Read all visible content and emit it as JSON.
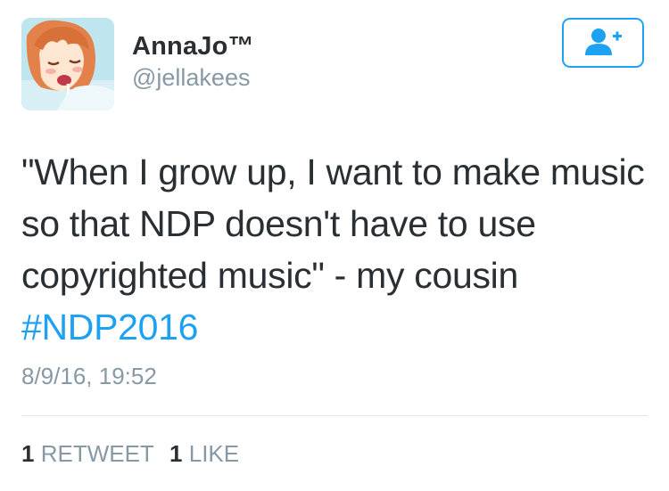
{
  "user": {
    "display_name": "AnnaJo™",
    "handle": "@jellakees",
    "avatar_icon": "anime-avatar"
  },
  "follow_button": {
    "icon": "follow-user-icon",
    "color": "#1da1f2"
  },
  "tweet": {
    "lines": [
      "\"When I grow up, I want to make music",
      "so that NDP doesn't have to use",
      "copyrighted music\" - my cousin"
    ],
    "hashtag": "#NDP2016",
    "timestamp": "8/9/16, 19:52"
  },
  "stats": {
    "retweets_count": "1",
    "retweets_label": "RETWEET",
    "likes_count": "1",
    "likes_label": "LIKE"
  },
  "colors": {
    "text": "#292f33",
    "muted": "#8899a6",
    "link": "#1da1f2",
    "divider": "#e1e8ed"
  }
}
